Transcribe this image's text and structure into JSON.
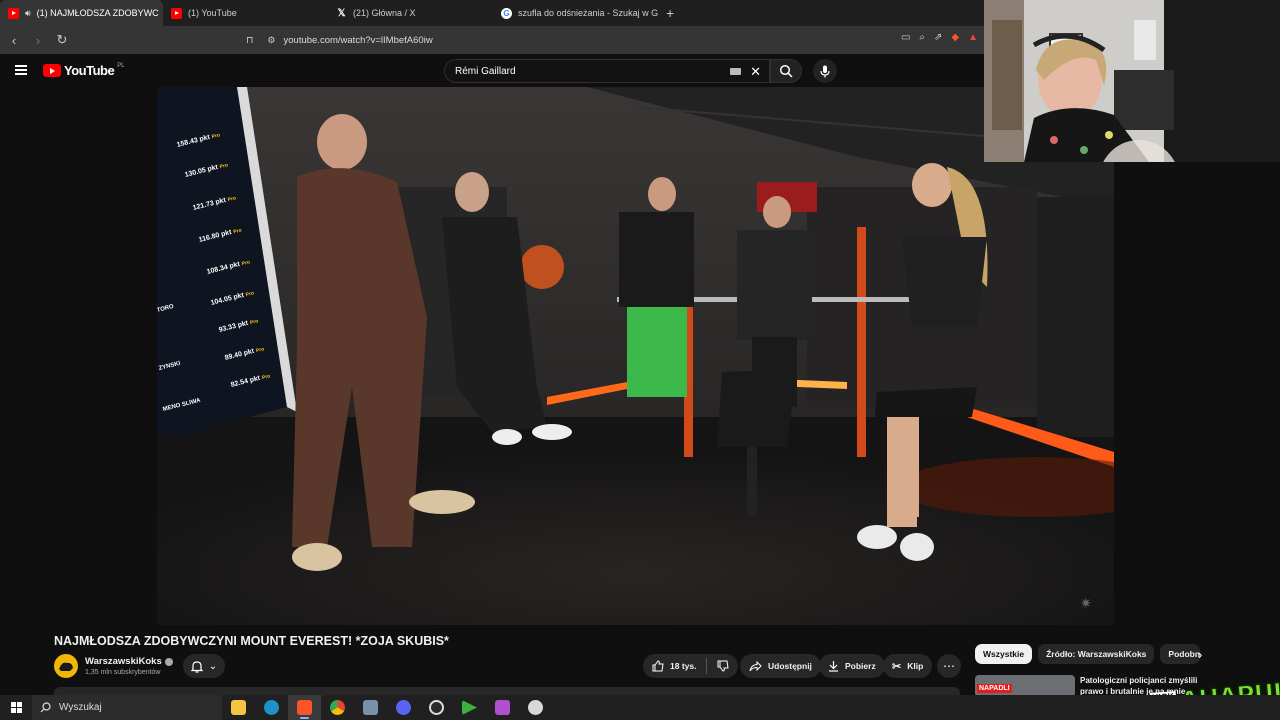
{
  "browser": {
    "tabs": [
      {
        "label": "(1) NAJMŁODSZA ZDOBYWC",
        "icon": "youtube-favicon",
        "active": true
      },
      {
        "label": "(1) YouTube",
        "icon": "youtube-favicon",
        "active": false
      },
      {
        "label": "(21) Główna / X",
        "icon": "x-favicon",
        "active": false
      },
      {
        "label": "szufla do odśnieżania - Szukaj w Goo",
        "icon": "google-favicon",
        "active": false
      }
    ],
    "new_tab": "+",
    "url": "youtube.com/watch?v=lIMbefA60iw"
  },
  "youtube": {
    "logo_text": "YouTube",
    "region": "PL",
    "search_value": "Rémi Gaillard"
  },
  "video": {
    "scores": [
      "158.43 pkt",
      "130.05 pkt",
      "121.73 pkt",
      "116.80 pkt",
      "108.34 pkt",
      "104.05 pkt",
      "93.33 pkt",
      "89.40 pkt",
      "82.54 pkt"
    ],
    "score_unit": "Pro",
    "names": [
      "TORO",
      "ZYNSKI",
      "MENO SLIWA"
    ]
  },
  "info": {
    "title": "NAJMŁODSZA ZDOBYWCZYNI MOUNT EVEREST! *ZOJA SKUBIS*",
    "channel": "WarszawskiKoks",
    "subscribers": "1,35 mln subskrybentów",
    "likes": "18 tys.",
    "share": "Udostępnij",
    "download": "Pobierz",
    "clip": "Klip",
    "chips": [
      "Wszystkie",
      "Źródło: WarszawskiKoks",
      "Podobne"
    ],
    "rec_badge": "NAPADLI",
    "rec_title": "Patologiczni policjanci zmyślili prawo i brutalnie je na mnie"
  },
  "overlay": {
    "kick": "KICK",
    "brand": "AHAPULCO"
  },
  "taskbar": {
    "search_placeholder": "Wyszukaj"
  }
}
